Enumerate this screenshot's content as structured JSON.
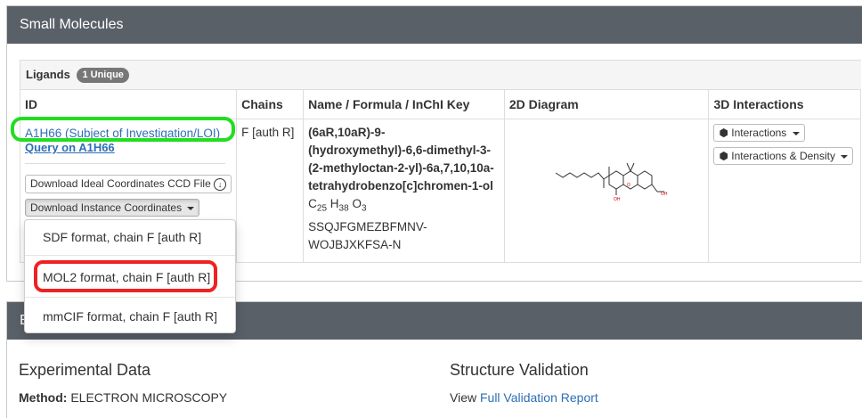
{
  "panel1": {
    "title": "Small Molecules"
  },
  "ligands": {
    "label": "Ligands",
    "badge": "1 Unique"
  },
  "table": {
    "headers": [
      "ID",
      "Chains",
      "Name / Formula / InChI Key",
      "2D Diagram",
      "3D Interactions"
    ],
    "row": {
      "id_link": "A1H66 (Subject of Investigation/LOI)",
      "query_link": "Query on A1H66",
      "download_ideal": "Download Ideal Coordinates CCD File",
      "download_instance": "Download Instance Coordinates",
      "chains": "F [auth R]",
      "name_lines": [
        "(6aR,10aR)-9-",
        "(hydroxymethyl)-6,6-dimethyl-3-",
        "(2-methyloctan-2-yl)-6a,7,10,10a-",
        "tetrahydrobenzo[c]chromen-1-ol"
      ],
      "formula": {
        "c": "C",
        "c_n": "25",
        "h": "H",
        "h_n": "38",
        "o": "O",
        "o_n": "3"
      },
      "inchi_lines": [
        "SSQJFGMEZBFMNV-",
        "WOJBJXKFSA-N"
      ],
      "interactions_btn": "Interactions",
      "interactions_density_btn": "Interactions & Density"
    }
  },
  "dropdown": {
    "items": [
      "SDF format, chain F [auth R]",
      "MOL2 format, chain F [auth R]",
      "mmCIF format, chain F [auth R]"
    ]
  },
  "panel2": {
    "title_partial": "E",
    "experimental_title": "Experimental Data",
    "method_label": "Method:",
    "method_value": "ELECTRON MICROSCOPY",
    "validation_title": "Structure Validation",
    "view_text": "View",
    "validation_link": "Full Validation Report"
  },
  "colors": {
    "header_bg": "#5a6068",
    "link": "#2d6fb5",
    "highlight_green": "#22dd22",
    "highlight_red": "#ee2222"
  }
}
